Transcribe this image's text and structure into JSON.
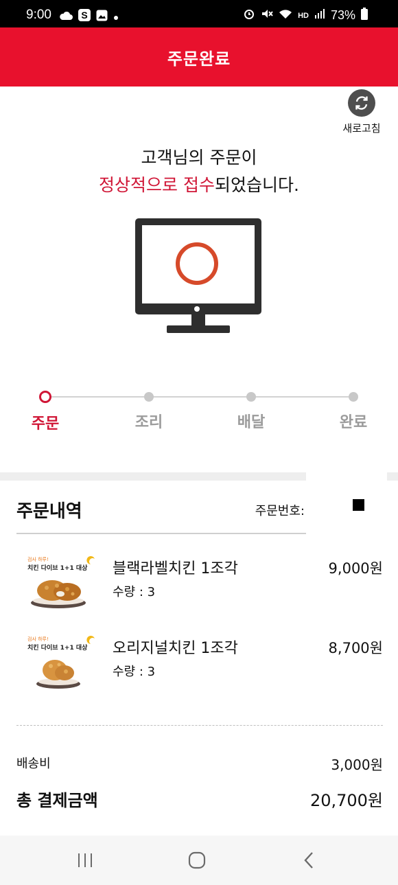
{
  "status_bar": {
    "time": "9:00",
    "battery": "73%",
    "network_label": "HD"
  },
  "header": {
    "title": "주문완료"
  },
  "refresh": {
    "label": "새로고침"
  },
  "message": {
    "line1": "고객님의 주문이",
    "line2_red_a": "정상적으로 접수",
    "line2_rest": "되었습니다."
  },
  "progress": {
    "current_step": 0,
    "steps": [
      {
        "label": "주문"
      },
      {
        "label": "조리"
      },
      {
        "label": "배달"
      },
      {
        "label": "완료"
      }
    ]
  },
  "order": {
    "title": "주문내역",
    "order_number_label": "주문번호:",
    "items": [
      {
        "name": "블랙라벨치킨 1조각",
        "qty": "수량 : 3",
        "price": "9,000원",
        "badge_top": "검사 하루!",
        "badge_main": "치킨 다이브 1+1 대상"
      },
      {
        "name": "오리지널치킨 1조각",
        "qty": "수량 : 3",
        "price": "8,700원",
        "badge_top": "검사 하루!",
        "badge_main": "치킨 다이브 1+1 대상"
      }
    ],
    "delivery_fee_label": "배송비",
    "delivery_fee_value": "3,000원",
    "total_label": "총 결제금액",
    "total_value": "20,700원"
  },
  "colors": {
    "brand_red": "#e8112d",
    "accent_red": "#d01636"
  }
}
